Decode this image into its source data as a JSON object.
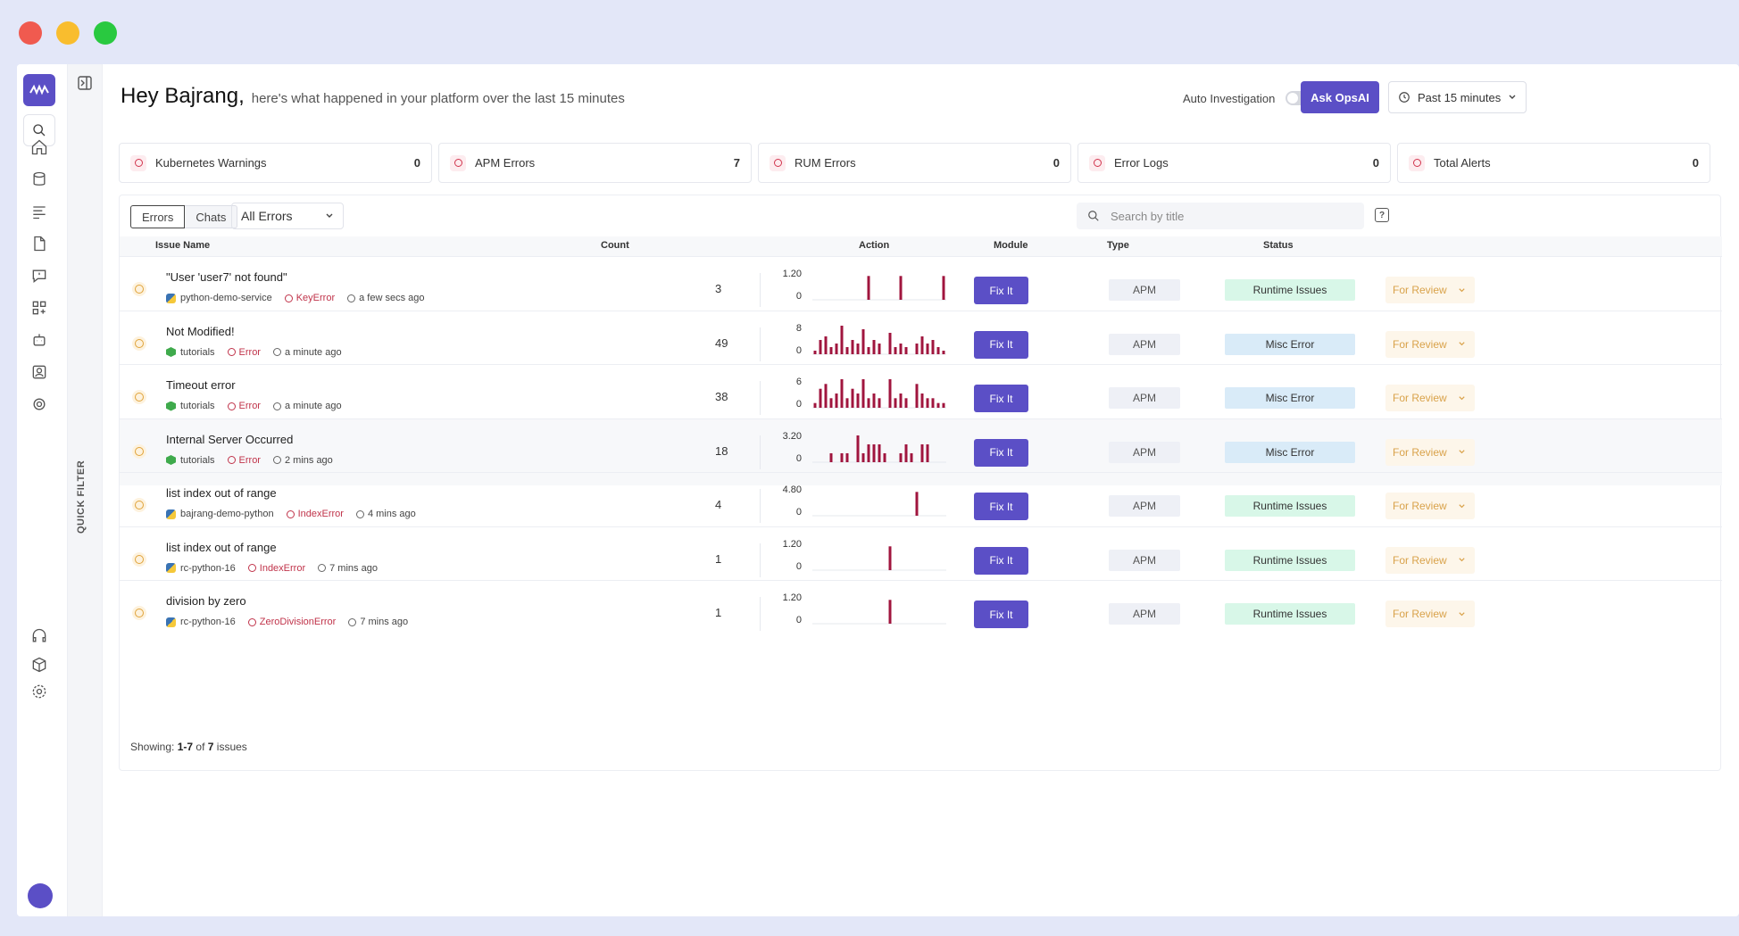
{
  "window_controls": {
    "close_color": "#f05a4f",
    "minimize_color": "#f9bd2e",
    "maximize_color": "#29c940"
  },
  "header": {
    "greeting": "Hey Bajrang,",
    "subtitle": "here's what happened in your platform over the last 15 minutes",
    "auto_investigation_label": "Auto Investigation",
    "auto_investigation_on": false,
    "ask_button": "Ask OpsAI",
    "time_range": "Past 15 minutes"
  },
  "quick_filter_label": "QUICK FILTER",
  "summary_cards": [
    {
      "label": "Kubernetes Warnings",
      "value": "0",
      "icon": "kubernetes-icon"
    },
    {
      "label": "APM Errors",
      "value": "7",
      "icon": "alert-circle-icon"
    },
    {
      "label": "RUM Errors",
      "value": "0",
      "icon": "rum-icon"
    },
    {
      "label": "Error Logs",
      "value": "0",
      "icon": "log-file-icon"
    },
    {
      "label": "Total Alerts",
      "value": "0",
      "icon": "bell-icon"
    }
  ],
  "toolbar": {
    "tab_errors": "Errors",
    "tab_chats": "Chats",
    "filter_value": "All Errors",
    "search_placeholder": "Search by title"
  },
  "table": {
    "headers": {
      "issue": "Issue Name",
      "count": "Count",
      "action": "Action",
      "module": "Module",
      "type": "Type",
      "status": "Status"
    },
    "rows": [
      {
        "title": "\"User 'user7' not found\"",
        "service": "python-demo-service",
        "service_kind": "python",
        "error": "KeyError",
        "time": "a few secs ago",
        "count": "3",
        "ymax": "1.20",
        "ymin": "0",
        "series": [
          0,
          0,
          0,
          0,
          0,
          0,
          0,
          0,
          0,
          0,
          1,
          0,
          0,
          0,
          0,
          0,
          1,
          0,
          0,
          0,
          0,
          0,
          0,
          0,
          1
        ],
        "action": "Fix It",
        "module": "APM",
        "type": "Runtime Issues",
        "type_kind": "runtime",
        "status": "For Review"
      },
      {
        "title": "Not Modified!",
        "service": "tutorials",
        "service_kind": "node",
        "error": "Error",
        "time": "a minute ago",
        "count": "49",
        "ymax": "8",
        "ymin": "0",
        "series": [
          1,
          4,
          5,
          2,
          3,
          8,
          2,
          4,
          3,
          7,
          2,
          4,
          3,
          0,
          6,
          2,
          3,
          2,
          0,
          3,
          5,
          3,
          4,
          2,
          1
        ],
        "action": "Fix It",
        "module": "APM",
        "type": "Misc Error",
        "type_kind": "misc",
        "status": "For Review"
      },
      {
        "title": "Timeout error",
        "service": "tutorials",
        "service_kind": "node",
        "error": "Error",
        "time": "a minute ago",
        "count": "38",
        "ymax": "6",
        "ymin": "0",
        "series": [
          1,
          4,
          5,
          2,
          3,
          6,
          2,
          4,
          3,
          6,
          2,
          3,
          2,
          0,
          6,
          2,
          3,
          2,
          0,
          5,
          3,
          2,
          2,
          1,
          1
        ],
        "action": "Fix It",
        "module": "APM",
        "type": "Misc Error",
        "type_kind": "misc",
        "status": "For Review"
      },
      {
        "title": "Internal Server Occurred",
        "service": "tutorials",
        "service_kind": "node",
        "error": "Error",
        "time": "2 mins ago",
        "count": "18",
        "ymax": "3.20",
        "ymin": "0",
        "series": [
          0,
          0,
          0,
          1,
          0,
          1,
          1,
          0,
          3,
          1,
          2,
          2,
          2,
          1,
          0,
          0,
          1,
          2,
          1,
          0,
          2,
          2,
          0,
          0,
          0
        ],
        "action": "Fix It",
        "module": "APM",
        "type": "Misc Error",
        "type_kind": "misc",
        "status": "For Review"
      },
      {
        "title": "list index out of range",
        "service": "bajrang-demo-python",
        "service_kind": "python",
        "error": "IndexError",
        "time": "4 mins ago",
        "count": "4",
        "ymax": "4.80",
        "ymin": "0",
        "series": [
          0,
          0,
          0,
          0,
          0,
          0,
          0,
          0,
          0,
          0,
          0,
          0,
          0,
          0,
          0,
          0,
          0,
          0,
          0,
          4,
          0,
          0,
          0,
          0,
          0
        ],
        "action": "Fix It",
        "module": "APM",
        "type": "Runtime Issues",
        "type_kind": "runtime",
        "status": "For Review"
      },
      {
        "title": "list index out of range",
        "service": "rc-python-16",
        "service_kind": "python",
        "error": "IndexError",
        "time": "7 mins ago",
        "count": "1",
        "ymax": "1.20",
        "ymin": "0",
        "series": [
          0,
          0,
          0,
          0,
          0,
          0,
          0,
          0,
          0,
          0,
          0,
          0,
          0,
          0,
          1,
          0,
          0,
          0,
          0,
          0,
          0,
          0,
          0,
          0,
          0
        ],
        "action": "Fix It",
        "module": "APM",
        "type": "Runtime Issues",
        "type_kind": "runtime",
        "status": "For Review"
      },
      {
        "title": "division by zero",
        "service": "rc-python-16",
        "service_kind": "python",
        "error": "ZeroDivisionError",
        "time": "7 mins ago",
        "count": "1",
        "ymax": "1.20",
        "ymin": "0",
        "series": [
          0,
          0,
          0,
          0,
          0,
          0,
          0,
          0,
          0,
          0,
          0,
          0,
          0,
          0,
          1,
          0,
          0,
          0,
          0,
          0,
          0,
          0,
          0,
          0,
          0
        ],
        "action": "Fix It",
        "module": "APM",
        "type": "Runtime Issues",
        "type_kind": "runtime",
        "status": "For Review"
      }
    ]
  },
  "footer": {
    "prefix": "Showing:",
    "range": "1-7",
    "of_text": "of",
    "total": "7",
    "suffix": "issues"
  },
  "colors": {
    "accent": "#5b4fc6",
    "spark_bar": "#a0153e",
    "runtime_bg": "#d8f7e8",
    "misc_bg": "#d9ebf8"
  }
}
